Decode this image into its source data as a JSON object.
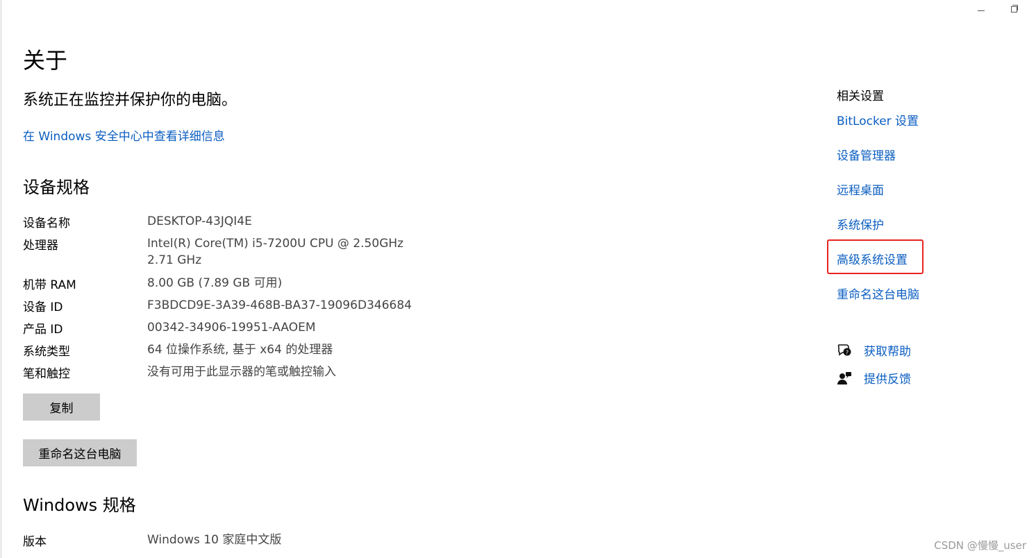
{
  "window": {
    "minimize_icon": "minimize-icon",
    "restore_icon": "restore-icon"
  },
  "title": "关于",
  "protection": {
    "status_text": "系统正在监控并保护你的电脑。",
    "details_link": "在 Windows 安全中心中查看详细信息"
  },
  "device_specs": {
    "heading": "设备规格",
    "rows": [
      {
        "label": "设备名称",
        "value": "DESKTOP-43JQI4E"
      },
      {
        "label": "处理器",
        "value": "Intel(R) Core(TM) i5-7200U CPU @ 2.50GHz",
        "value_line2": "2.71 GHz"
      },
      {
        "label": "机带 RAM",
        "value": "8.00 GB (7.89 GB 可用)"
      },
      {
        "label": "设备 ID",
        "value": "F3BDCD9E-3A39-468B-BA37-19096D346684"
      },
      {
        "label": "产品 ID",
        "value": "00342-34906-19951-AAOEM"
      },
      {
        "label": "系统类型",
        "value": "64 位操作系统, 基于 x64 的处理器"
      },
      {
        "label": "笔和触控",
        "value": "没有可用于此显示器的笔或触控输入"
      }
    ],
    "copy_button": "复制",
    "rename_button": "重命名这台电脑"
  },
  "windows_specs": {
    "heading": "Windows 规格",
    "rows": [
      {
        "label": "版本",
        "value": "Windows 10 家庭中文版"
      }
    ]
  },
  "related_settings": {
    "title": "相关设置",
    "links": [
      "BitLocker 设置",
      "设备管理器",
      "远程桌面",
      "系统保护",
      "高级系统设置",
      "重命名这台电脑"
    ],
    "highlighted_index": 4,
    "highlight_color": "#e8231f"
  },
  "help": {
    "get_help": "获取帮助",
    "feedback": "提供反馈",
    "get_help_icon": "chat-help-icon",
    "feedback_icon": "person-feedback-icon"
  },
  "colors": {
    "link": "#0b5ec1",
    "button_bg": "#cccccc",
    "value_text": "#444444"
  },
  "watermark": "CSDN @慢慢_user"
}
